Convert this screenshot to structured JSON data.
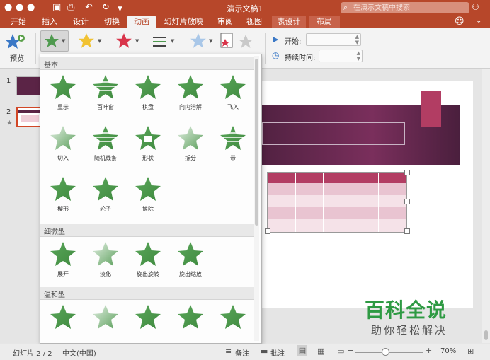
{
  "window": {
    "title": "演示文稿1",
    "search_placeholder": "在演示文稿中搜索"
  },
  "tabs": [
    {
      "label": "开始"
    },
    {
      "label": "插入"
    },
    {
      "label": "设计"
    },
    {
      "label": "切换"
    },
    {
      "label": "动画",
      "active": true
    },
    {
      "label": "幻灯片放映"
    },
    {
      "label": "审阅"
    },
    {
      "label": "视图"
    },
    {
      "label": "表设计",
      "contextual": true
    },
    {
      "label": "布局",
      "contextual": true
    }
  ],
  "ribbon": {
    "preview_label": "预览",
    "start_label": "开始:",
    "duration_label": "持续时间:",
    "start_value": "",
    "duration_value": ""
  },
  "slides": {
    "items": [
      {
        "number": "1"
      },
      {
        "number": "2"
      }
    ]
  },
  "gallery": {
    "sections": [
      {
        "label": "基本",
        "items": [
          "显示",
          "百叶窗",
          "棋盘",
          "向内溶解",
          "飞入",
          "切入",
          "随机线条",
          "形状",
          "拆分",
          "带",
          "楔形",
          "轮子",
          "擦除"
        ]
      },
      {
        "label": "细微型",
        "items": [
          "展开",
          "淡化",
          "旋出旋转",
          "旋出缩放"
        ]
      },
      {
        "label": "温和型",
        "items": [
          "",
          "",
          "",
          "",
          ""
        ]
      }
    ]
  },
  "status": {
    "slide_info": "幻灯片 2 / 2",
    "language": "中文(中国)",
    "notes_label": "备注",
    "comments_label": "批注",
    "zoom": "70%"
  },
  "watermark": {
    "line1": "百科全说",
    "line2": "助你轻松解决"
  },
  "colors": {
    "brand": "#b7472a",
    "star_green": "#4f9a4f",
    "slide_purple": "#5b2446",
    "table_header": "#b23d63"
  }
}
